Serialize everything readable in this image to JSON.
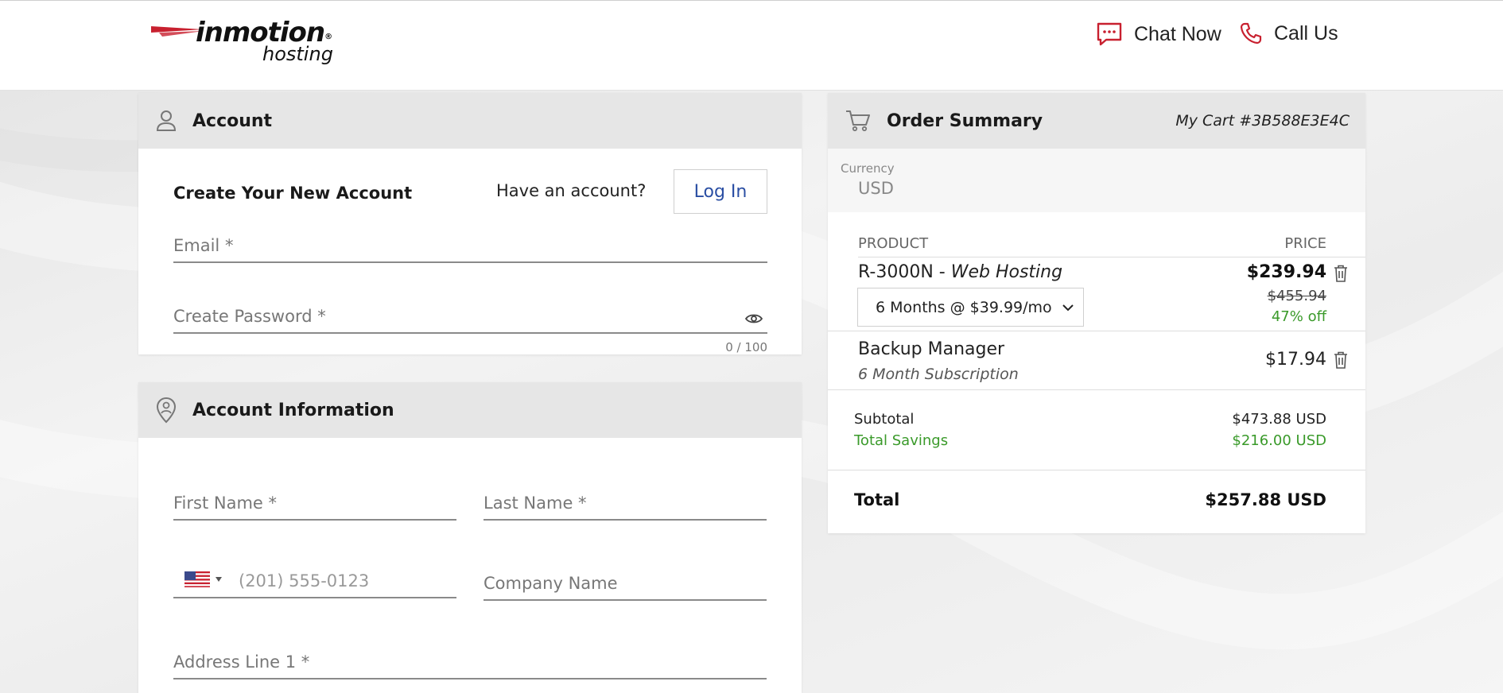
{
  "header": {
    "brand": "inmotion",
    "brand_sub": "hosting",
    "registered": "®",
    "chat_label": "Chat Now",
    "call_label": "Call Us"
  },
  "account": {
    "title": "Account",
    "create_heading": "Create Your New Account",
    "have_account": "Have an account?",
    "login_label": "Log In",
    "email_placeholder": "Email *",
    "password_placeholder": "Create Password *",
    "password_counter": "0 / 100"
  },
  "account_info": {
    "title": "Account Information",
    "first_name_placeholder": "First Name *",
    "last_name_placeholder": "Last Name *",
    "phone_placeholder": "(201) 555-0123",
    "company_placeholder": "Company Name",
    "address1_placeholder": "Address Line 1 *"
  },
  "order": {
    "title": "Order Summary",
    "cart_id": "My Cart #3B588E3E4C",
    "currency_label": "Currency",
    "currency_value": "USD",
    "col_product": "PRODUCT",
    "col_price": "PRICE",
    "items": [
      {
        "name": "R-3000N - ",
        "name_italic": "Web Hosting",
        "term": "6 Months @ $39.99/mo",
        "price": "$239.94",
        "original_price": "$455.94",
        "discount": "47% off"
      },
      {
        "name": "Backup Manager",
        "subtitle": "6 Month Subscription",
        "price": "$17.94"
      }
    ],
    "subtotal_label": "Subtotal",
    "subtotal_value": "$473.88 USD",
    "savings_label": "Total Savings",
    "savings_value": "$216.00 USD",
    "total_label": "Total",
    "total_value": "$257.88 USD"
  },
  "colors": {
    "accent_red": "#c8202f",
    "link_blue": "#2a4ea3",
    "savings_green": "#3a9a2a"
  }
}
